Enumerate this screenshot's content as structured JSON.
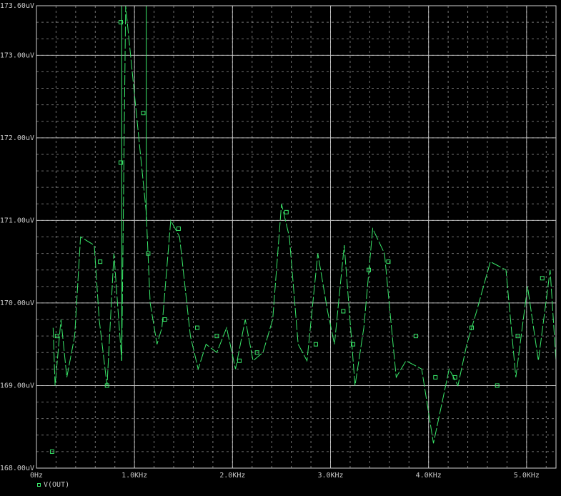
{
  "chart_data": {
    "type": "line",
    "xlim": [
      0,
      5.3
    ],
    "ylim": [
      168.0,
      173.6
    ],
    "grid": true,
    "x_ticks": [
      {
        "value": 0,
        "label": "0Hz"
      },
      {
        "value": 1.0,
        "label": "1.0KHz"
      },
      {
        "value": 2.0,
        "label": "2.0KHz"
      },
      {
        "value": 3.0,
        "label": "3.0KHz"
      },
      {
        "value": 4.0,
        "label": "4.0KHz"
      },
      {
        "value": 5.0,
        "label": "5.0KHz"
      }
    ],
    "y_ticks": [
      {
        "value": 168.0,
        "label": "168.00uV"
      },
      {
        "value": 169.0,
        "label": "169.00uV"
      },
      {
        "value": 170.0,
        "label": "170.00uV"
      },
      {
        "value": 171.0,
        "label": "171.00uV"
      },
      {
        "value": 172.0,
        "label": "172.00uV"
      },
      {
        "value": 173.0,
        "label": "173.00uV"
      },
      {
        "value": 173.6,
        "label": "173.60uV"
      }
    ],
    "colors": {
      "series": "#39e86a",
      "grid": "#d0d0d0",
      "frame": "#d0d0d0",
      "text": "#c8c8c8"
    },
    "series": [
      {
        "name": "V(OUT)",
        "x": [
          0.17,
          0.19,
          0.25,
          0.31,
          0.39,
          0.45,
          0.59,
          0.64,
          0.72,
          0.79,
          0.87,
          0.91,
          1.12,
          1.16,
          1.23,
          1.28,
          1.37,
          1.46,
          1.57,
          1.65,
          1.73,
          1.84,
          1.94,
          2.03,
          2.13,
          2.21,
          2.31,
          2.41,
          2.5,
          2.58,
          2.67,
          2.76,
          2.87,
          2.97,
          3.04,
          3.14,
          3.25,
          3.34,
          3.43,
          3.55,
          3.67,
          3.77,
          3.93,
          4.05,
          4.21,
          4.3,
          4.39,
          4.49,
          4.63,
          4.79,
          4.89,
          5.01,
          5.12,
          5.24,
          5.3
        ],
        "y": [
          169.7,
          169.0,
          169.8,
          169.1,
          169.6,
          170.8,
          170.7,
          169.8,
          169.0,
          170.6,
          169.3,
          173.6,
          171.1,
          170.0,
          169.5,
          169.7,
          171.0,
          170.8,
          169.6,
          169.2,
          169.5,
          169.4,
          169.7,
          169.2,
          169.8,
          169.3,
          169.4,
          169.8,
          171.2,
          170.8,
          169.5,
          169.3,
          170.6,
          169.9,
          169.5,
          170.7,
          169.0,
          169.7,
          170.9,
          170.6,
          169.1,
          169.3,
          169.2,
          168.3,
          169.2,
          169.0,
          169.5,
          169.9,
          170.5,
          170.4,
          169.1,
          170.2,
          169.3,
          170.4,
          169.3
        ],
        "markers_x": [
          0.16,
          0.21,
          0.65,
          0.72,
          0.86,
          0.86,
          1.09,
          1.14,
          1.31,
          1.45,
          1.64,
          1.84,
          2.07,
          2.25,
          2.55,
          2.85,
          3.13,
          3.23,
          3.39,
          3.59,
          3.87,
          4.07,
          4.27,
          4.44,
          4.7,
          4.91,
          5.16
        ],
        "markers_y": [
          168.2,
          169.6,
          170.5,
          169.0,
          173.4,
          171.7,
          172.3,
          170.6,
          169.8,
          170.9,
          169.7,
          169.6,
          169.3,
          169.4,
          171.1,
          169.5,
          169.9,
          169.5,
          170.4,
          170.5,
          169.6,
          169.1,
          169.1,
          169.7,
          169.0,
          169.6,
          170.3
        ]
      }
    ]
  }
}
